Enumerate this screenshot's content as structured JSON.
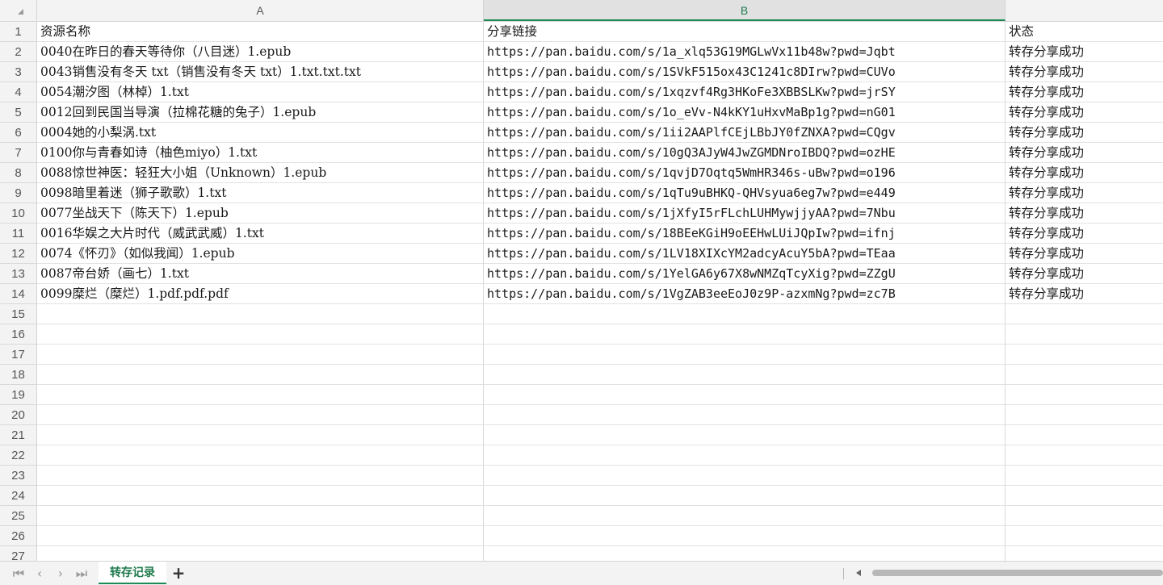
{
  "columns": [
    "A",
    "B"
  ],
  "headers": {
    "name": "资源名称",
    "link": "分享链接",
    "status": "状态"
  },
  "rows": [
    {
      "name": "0040在昨日的春天等待你（八目迷）1.epub",
      "link": "https://pan.baidu.com/s/1a_xlq53G19MGLwVx11b48w?pwd=Jqbt",
      "status": "转存分享成功"
    },
    {
      "name": "0043销售没有冬天 txt（销售没有冬天 txt）1.txt.txt.txt",
      "link": "https://pan.baidu.com/s/1SVkF515ox43C1241c8DIrw?pwd=CUVo",
      "status": "转存分享成功"
    },
    {
      "name": "0054潮汐图（林棹）1.txt",
      "link": "https://pan.baidu.com/s/1xqzvf4Rg3HKoFe3XBBSLKw?pwd=jrSY",
      "status": "转存分享成功"
    },
    {
      "name": "0012回到民国当导演（拉棉花糖的兔子）1.epub",
      "link": "https://pan.baidu.com/s/1o_eVv-N4kKY1uHxvMaBp1g?pwd=nG01",
      "status": "转存分享成功"
    },
    {
      "name": "0004她的小梨涡.txt",
      "link": "https://pan.baidu.com/s/1ii2AAPlfCEjLBbJY0fZNXA?pwd=CQgv",
      "status": "转存分享成功"
    },
    {
      "name": "0100你与青春如诗（柚色miyo）1.txt",
      "link": "https://pan.baidu.com/s/10gQ3AJyW4JwZGMDNroIBDQ?pwd=ozHE",
      "status": "转存分享成功"
    },
    {
      "name": "0088惊世神医：轻狂大小姐（Unknown）1.epub",
      "link": "https://pan.baidu.com/s/1qvjD7Oqtq5WmHR346s-uBw?pwd=o196",
      "status": "转存分享成功"
    },
    {
      "name": "0098暗里着迷（狮子歌歌）1.txt",
      "link": "https://pan.baidu.com/s/1qTu9uBHKQ-QHVsyua6eg7w?pwd=e449",
      "status": "转存分享成功"
    },
    {
      "name": "0077坐战天下（陈天下）1.epub",
      "link": "https://pan.baidu.com/s/1jXfyI5rFLchLUHMywjjyAA?pwd=7Nbu",
      "status": "转存分享成功"
    },
    {
      "name": "0016华娱之大片时代（威武武威）1.txt",
      "link": "https://pan.baidu.com/s/18BEeKGiH9oEEHwLUiJQpIw?pwd=ifnj",
      "status": "转存分享成功"
    },
    {
      "name": "0074《怀刃》（如似我闻）1.epub",
      "link": "https://pan.baidu.com/s/1LV18XIXcYM2adcyAcuY5bA?pwd=TEaa",
      "status": "转存分享成功"
    },
    {
      "name": "0087帝台娇（画七）1.txt",
      "link": "https://pan.baidu.com/s/1YelGA6y67X8wNMZqTcyXig?pwd=ZZgU",
      "status": "转存分享成功"
    },
    {
      "name": "0099糜烂（糜烂）1.pdf.pdf.pdf",
      "link": "https://pan.baidu.com/s/1VgZAB3eeEoJ0z9P-azxmNg?pwd=zc7B",
      "status": "转存分享成功"
    }
  ],
  "row_numbers": [
    "1",
    "2",
    "3",
    "4",
    "5",
    "6",
    "7",
    "8",
    "9",
    "10",
    "11",
    "12",
    "13",
    "14",
    "15",
    "16",
    "17",
    "18",
    "19",
    "20",
    "21",
    "22",
    "23",
    "24",
    "25",
    "26",
    "27"
  ],
  "sheet_tab": "转存记录",
  "add_sheet": "+",
  "nav_icons": [
    "first-sheet-icon",
    "prev-sheet-icon",
    "next-sheet-icon",
    "last-sheet-icon"
  ],
  "nav_glyphs": [
    "|<",
    "<",
    ">",
    ">|"
  ],
  "colors": {
    "accent": "#1e8a55",
    "header_bg": "#f3f3f3",
    "grid_line": "#d9d9d9"
  }
}
